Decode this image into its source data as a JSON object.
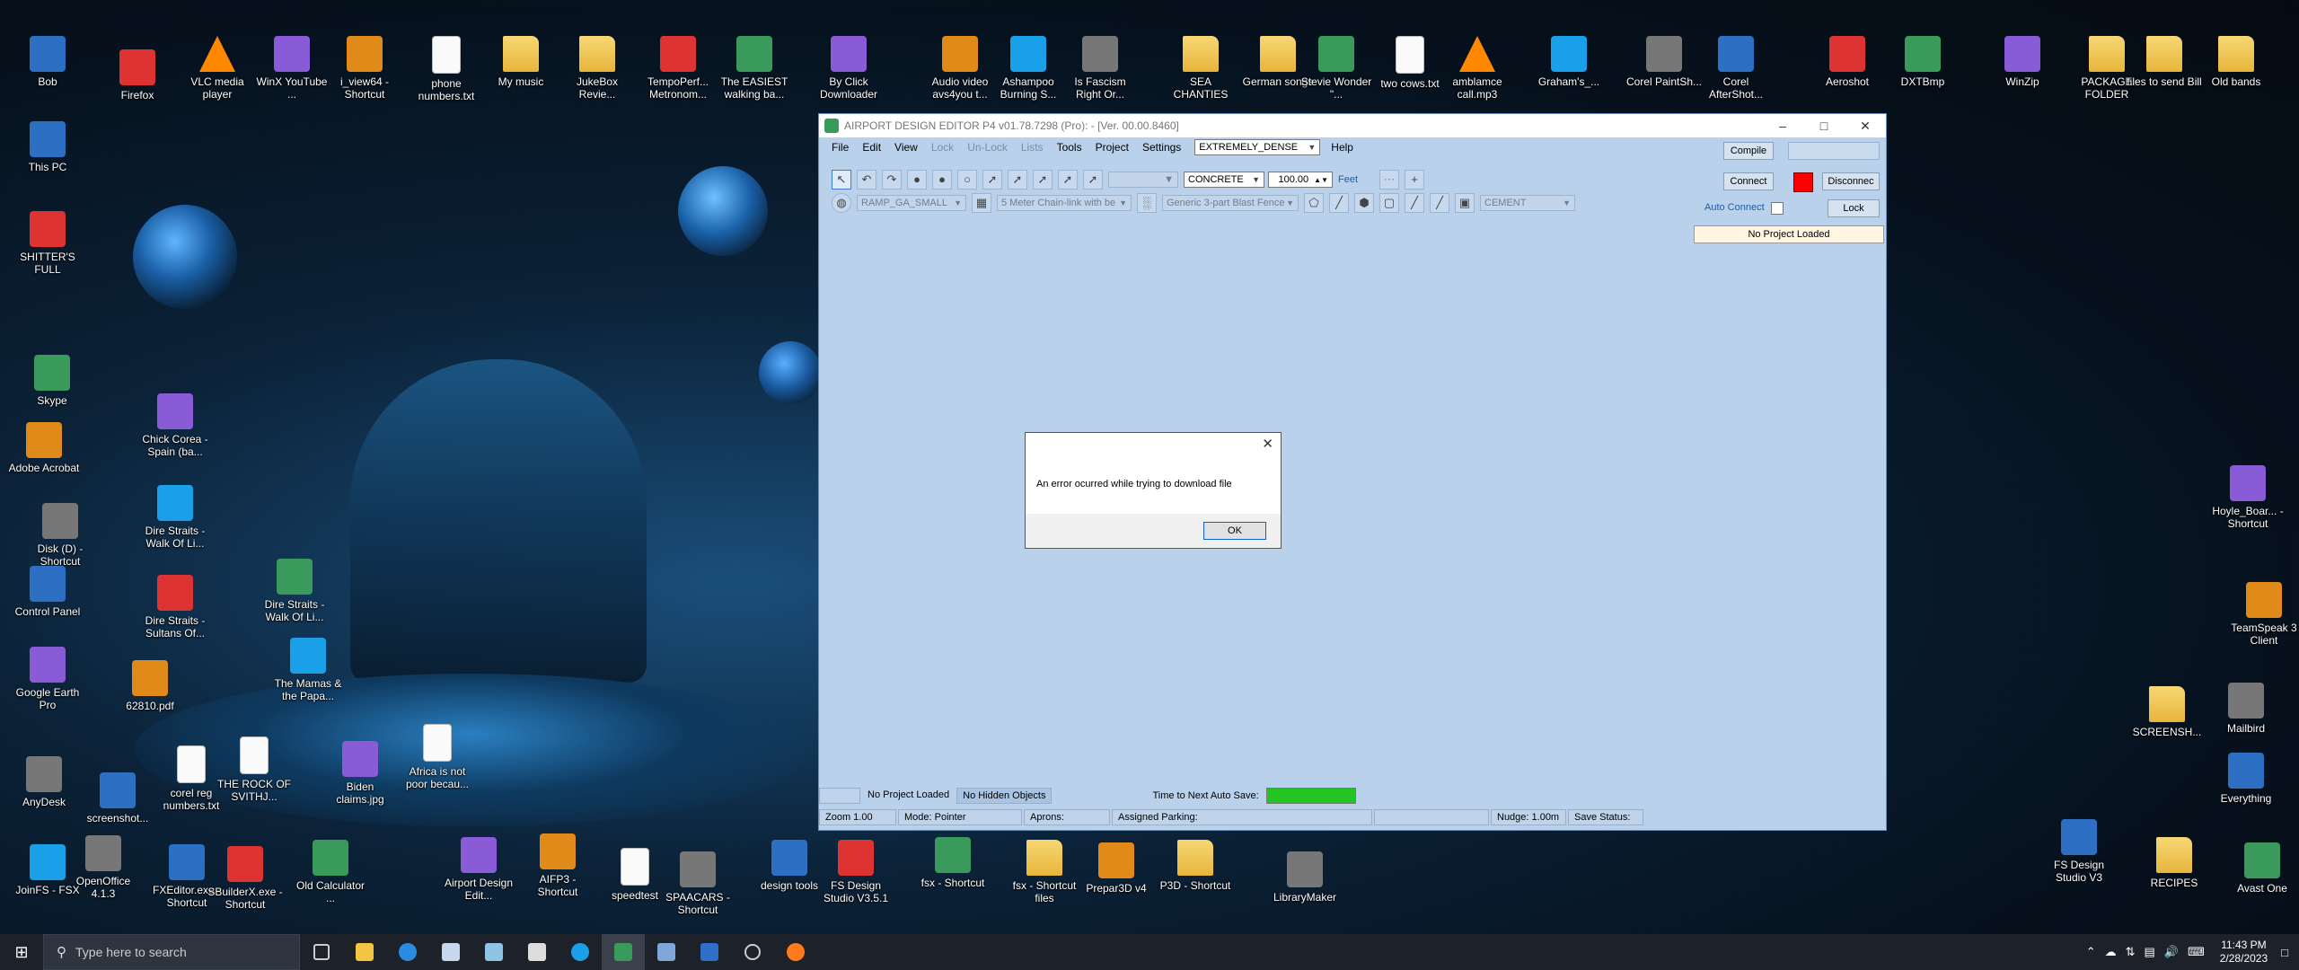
{
  "desktop": {
    "icons": [
      {
        "label": "Bob",
        "kind": "person-icon"
      },
      {
        "label": "Firefox",
        "kind": "firefox-icon"
      },
      {
        "label": "VLC media player",
        "kind": "vlc-icon"
      },
      {
        "label": "WinX YouTube ...",
        "kind": "youtube-icon"
      },
      {
        "label": "i_view64 - Shortcut",
        "kind": "irfanview-icon"
      },
      {
        "label": "phone numbers.txt",
        "kind": "text-file-icon"
      },
      {
        "label": "My music",
        "kind": "folder-icon"
      },
      {
        "label": "JukeBox Revie...",
        "kind": "folder-icon"
      },
      {
        "label": "TempoPerf... Metronom...",
        "kind": "metronome-icon"
      },
      {
        "label": "The EASIEST walking ba...",
        "kind": "video-file-icon"
      },
      {
        "label": "By Click Downloader",
        "kind": "downloader-icon"
      },
      {
        "label": "Audio video avs4you t...",
        "kind": "speaker-icon"
      },
      {
        "label": "Ashampoo Burning S...",
        "kind": "disc-icon"
      },
      {
        "label": "Is Fascism Right Or...",
        "kind": "video-file-icon"
      },
      {
        "label": "SEA CHANTIES",
        "kind": "folder-icon"
      },
      {
        "label": "German songs",
        "kind": "folder-icon"
      },
      {
        "label": "Stevie Wonder \"...",
        "kind": "video-file-icon"
      },
      {
        "label": "two cows.txt",
        "kind": "text-file-icon"
      },
      {
        "label": "amblamce call.mp3",
        "kind": "vlc-icon"
      },
      {
        "label": "Graham's_...",
        "kind": "pyramid-icon"
      },
      {
        "label": "Corel PaintSh...",
        "kind": "camera-icon"
      },
      {
        "label": "Corel AfterShot...",
        "kind": "bird-icon"
      },
      {
        "label": "Aeroshot",
        "kind": "aeroshot-icon"
      },
      {
        "label": "DXTBmp",
        "kind": "plane-icon"
      },
      {
        "label": "WinZip",
        "kind": "winzip-icon"
      },
      {
        "label": "PACKAGE FOLDER",
        "kind": "folder-icon"
      },
      {
        "label": "files to send Bill",
        "kind": "folder-icon"
      },
      {
        "label": "Old bands",
        "kind": "folder-icon"
      },
      {
        "label": "This PC",
        "kind": "computer-icon"
      },
      {
        "label": "SHITTER'S FULL",
        "kind": "recycle-bin-icon"
      },
      {
        "label": "Skype",
        "kind": "skype-icon"
      },
      {
        "label": "Chick Corea - Spain (ba...",
        "kind": "video-file-icon"
      },
      {
        "label": "Adobe Acrobat",
        "kind": "acrobat-icon"
      },
      {
        "label": "Dire Straits - Walk Of Li...",
        "kind": "video-file-icon"
      },
      {
        "label": "Disk (D) - Shortcut",
        "kind": "disk-icon"
      },
      {
        "label": "Control Panel",
        "kind": "control-panel-icon"
      },
      {
        "label": "Dire Straits - Sultans Of...",
        "kind": "video-file-icon"
      },
      {
        "label": "Dire Straits - Walk Of Li...",
        "kind": "video-file-icon"
      },
      {
        "label": "Google Earth Pro",
        "kind": "globe-icon"
      },
      {
        "label": "62810.pdf",
        "kind": "pdf-icon"
      },
      {
        "label": "The Mamas & the Papa...",
        "kind": "video-file-icon"
      },
      {
        "label": "AnyDesk",
        "kind": "anydesk-icon"
      },
      {
        "label": "screenshot...",
        "kind": "image-file-icon"
      },
      {
        "label": "corel reg numbers.txt",
        "kind": "text-file-icon"
      },
      {
        "label": "THE ROCK OF SVITHJ...",
        "kind": "text-file-icon"
      },
      {
        "label": "Biden claims.jpg",
        "kind": "image-file-icon"
      },
      {
        "label": "Africa is not poor becau...",
        "kind": "text-file-icon"
      },
      {
        "label": "JoinFS - FSX",
        "kind": "plane-icon"
      },
      {
        "label": "OpenOffice 4.1.3",
        "kind": "openoffice-icon"
      },
      {
        "label": "FXEditor.exe - Shortcut",
        "kind": "house-icon"
      },
      {
        "label": "SBuilderX.exe - Shortcut",
        "kind": "x-icon"
      },
      {
        "label": "Old Calculator ...",
        "kind": "calculator-icon"
      },
      {
        "label": "Airport Design Edit...",
        "kind": "globe-icon"
      },
      {
        "label": "AIFP3 - Shortcut",
        "kind": "plane-icon"
      },
      {
        "label": "speedtest",
        "kind": "text-file-icon"
      },
      {
        "label": "SPAACARS - Shortcut",
        "kind": "app-icon"
      },
      {
        "label": "design tools",
        "kind": "tree-icon"
      },
      {
        "label": "FS Design Studio V3.5.1",
        "kind": "fsds-icon"
      },
      {
        "label": "fsx - Shortcut",
        "kind": "plane-icon"
      },
      {
        "label": "fsx - Shortcut files",
        "kind": "folder-icon"
      },
      {
        "label": "Prepar3D v4",
        "kind": "p3d-icon"
      },
      {
        "label": "P3D - Shortcut",
        "kind": "folder-icon"
      },
      {
        "label": "LibraryMaker",
        "kind": "library-icon"
      },
      {
        "label": "FS Design Studio V3",
        "kind": "fsds-icon"
      },
      {
        "label": "RECIPES",
        "kind": "folder-icon"
      },
      {
        "label": "Avast One",
        "kind": "avast-icon"
      },
      {
        "label": "Hoyle_Boar... - Shortcut",
        "kind": "cards-icon"
      },
      {
        "label": "TeamSpeak 3 Client",
        "kind": "teamspeak-icon"
      },
      {
        "label": "SCREENSH...",
        "kind": "folder-icon"
      },
      {
        "label": "Mailbird",
        "kind": "mail-icon"
      },
      {
        "label": "Everything",
        "kind": "search-icon"
      }
    ]
  },
  "app": {
    "title": "AIRPORT DESIGN EDITOR P4  v01.78.7298  (Pro):  - [Ver. 00.00.8460]",
    "menu": [
      {
        "label": "File",
        "enabled": true
      },
      {
        "label": "Edit",
        "enabled": true
      },
      {
        "label": "View",
        "enabled": true
      },
      {
        "label": "Lock",
        "enabled": false
      },
      {
        "label": "Un-Lock",
        "enabled": false
      },
      {
        "label": "Lists",
        "enabled": false
      },
      {
        "label": "Tools",
        "enabled": true
      },
      {
        "label": "Project",
        "enabled": true
      },
      {
        "label": "Settings",
        "enabled": true
      }
    ],
    "density_combo": "EXTREMELY_DENSE",
    "help_menu": "Help",
    "compile_button": "Compile",
    "connect_button": "Connect",
    "disconnect_button": "Disconnec",
    "auto_connect_label": "Auto Connect",
    "lock_button": "Lock",
    "project_status": "No Project Loaded",
    "surface_combo": "CONCRETE",
    "width_value": "100.00",
    "units_label": "Feet",
    "plus_label": "+",
    "ramp_combo": "RAMP_GA_SMALL",
    "fence_combo": "5 Meter Chain-link with be",
    "blast_fence_combo": "Generic 3-part Blast Fence",
    "cement_combo": "CEMENT",
    "status_top": {
      "project": "No Project Loaded",
      "hidden": "No Hidden Objects",
      "autosave_label": "Time to Next Auto Save:"
    },
    "status_bottom": {
      "zoom": "Zoom 1.00",
      "mode": "Mode: Pointer",
      "aprons": "Aprons:",
      "parking": "Assigned Parking:",
      "nudge": "Nudge: 1.00m",
      "save_status": "Save Status:"
    },
    "colors": {
      "client_bg": "#b9d1ea",
      "connect_indicator": "#ff0000",
      "autosave_bar": "#22c322"
    },
    "autosave_progress_pct": 100
  },
  "dialog": {
    "message": "An error ocurred while trying to download file",
    "ok_label": "OK"
  },
  "taskbar": {
    "search_placeholder": "Type here to search",
    "time": "11:43 PM",
    "date": "2/28/2023"
  }
}
